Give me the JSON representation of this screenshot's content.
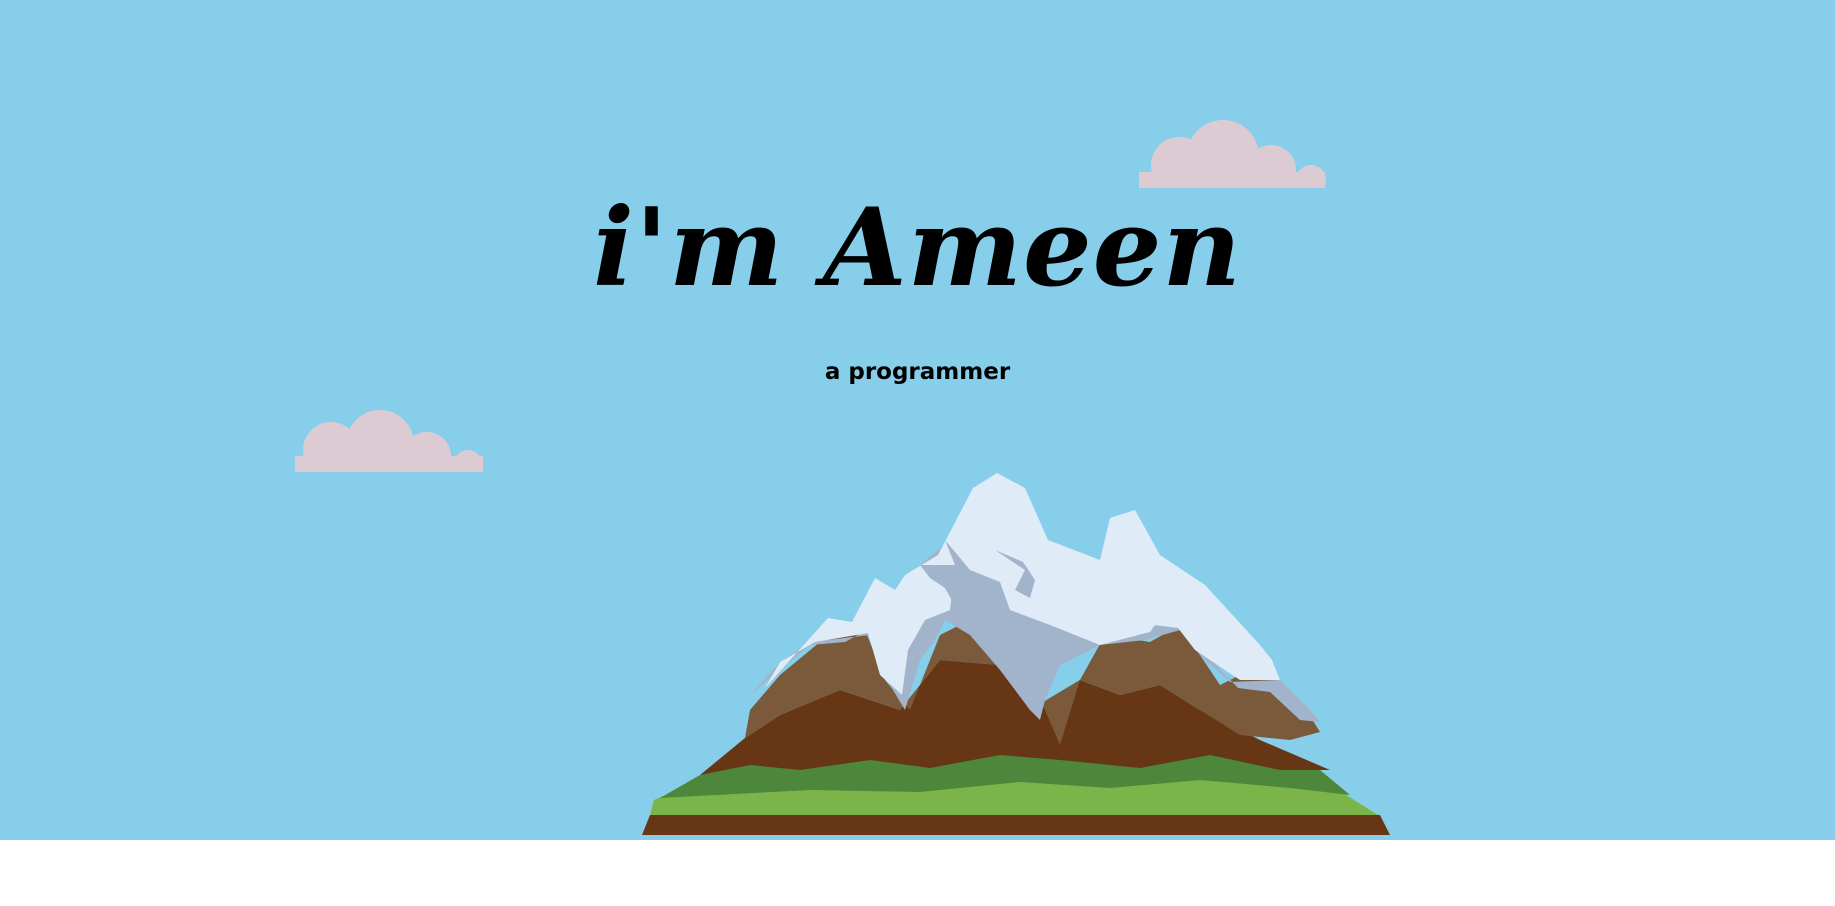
{
  "hero": {
    "title": "i'm Ameen",
    "subtitle": "a programmer"
  },
  "icons": {
    "cloud_left": "cloud-icon",
    "cloud_right": "cloud-icon",
    "mountain": "mountain-illustration"
  },
  "colors": {
    "sky": "#87ceea",
    "cloud": "#dccbd3",
    "snow": "#dfecf7",
    "snow_shadow": "#a2b4cc",
    "rock_light": "#7a5a3a",
    "rock_dark": "#673715",
    "grass_dark": "#4c873c",
    "grass_light": "#7bb54a"
  }
}
